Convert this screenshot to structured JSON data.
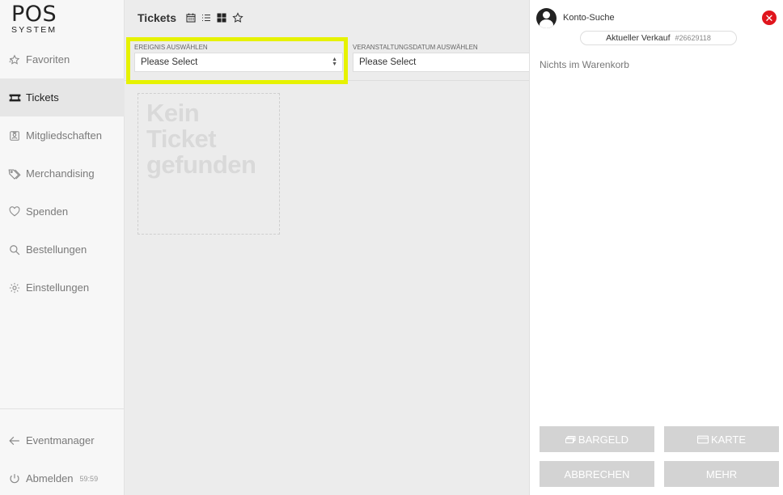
{
  "logo": {
    "big": "POS",
    "small": "SYSTEM"
  },
  "sidebar": {
    "items": [
      {
        "label": "Favoriten",
        "icon": "star-icon",
        "active": false
      },
      {
        "label": "Tickets",
        "icon": "ticket-icon",
        "active": true
      },
      {
        "label": "Mitgliedschaften",
        "icon": "member-card-icon",
        "active": false
      },
      {
        "label": "Merchandising",
        "icon": "tag-icon",
        "active": false
      },
      {
        "label": "Spenden",
        "icon": "heart-icon",
        "active": false
      },
      {
        "label": "Bestellungen",
        "icon": "search-icon",
        "active": false
      },
      {
        "label": "Einstellungen",
        "icon": "gear-icon",
        "active": false
      }
    ],
    "bottom": [
      {
        "label": "Eventmanager",
        "icon": "arrow-left-icon"
      },
      {
        "label": "Abmelden",
        "icon": "power-icon",
        "timer": "59:59"
      }
    ]
  },
  "main": {
    "title": "Tickets",
    "view_icons": [
      "calendar-icon",
      "list-icon",
      "grid-icon",
      "star-outline-icon"
    ],
    "filters": [
      {
        "label": "EREIGNIS AUSWÄHLEN",
        "value": "Please Select"
      },
      {
        "label": "VERANSTALTUNGSDATUM AUSWÄHLEN",
        "value": "Please Select"
      }
    ],
    "empty_text_line1": "Kein Ticket",
    "empty_text_line2": "gefunden"
  },
  "cart": {
    "account_label": "Konto-Suche",
    "sale_label": "Aktueller Verkauf",
    "sale_number": "#26629118",
    "empty_text": "Nichts im Warenkorb",
    "buttons": {
      "cash": "BARGELD",
      "card": "KARTE",
      "cancel": "ABBRECHEN",
      "more": "MEHR"
    }
  },
  "colors": {
    "highlight": "#e6f200",
    "close": "#e0151d",
    "button_disabled": "#d3d3d3"
  }
}
